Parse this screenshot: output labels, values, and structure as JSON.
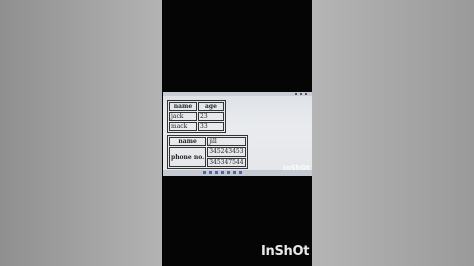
{
  "table1": {
    "headers": [
      "name",
      "age"
    ],
    "rows": [
      [
        "jack",
        "23"
      ],
      [
        "mack",
        "33"
      ]
    ]
  },
  "table2": {
    "name_header": "name",
    "name_value": "jill",
    "phone_label": "phone no.",
    "phones": [
      "345243453",
      "345347544"
    ]
  },
  "watermark": {
    "small": "InShOt",
    "large": "InShOt"
  }
}
